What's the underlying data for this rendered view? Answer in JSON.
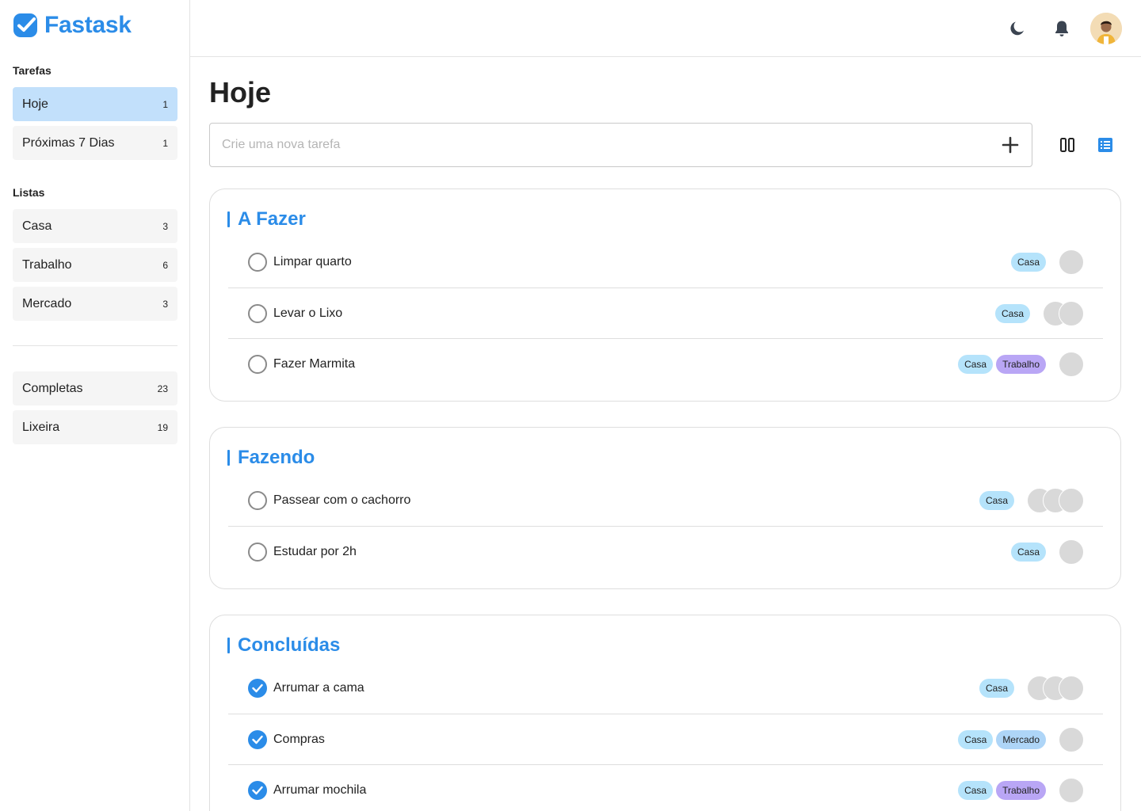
{
  "app": {
    "name": "Fastask",
    "accent": "#2b8ce8"
  },
  "sidebar": {
    "tasks_label": "Tarefas",
    "tasks": [
      {
        "label": "Hoje",
        "count": "1",
        "active": true
      },
      {
        "label": "Próximas 7 Dias",
        "count": "1",
        "active": false
      }
    ],
    "lists_label": "Listas",
    "lists": [
      {
        "label": "Casa",
        "count": "3"
      },
      {
        "label": "Trabalho",
        "count": "6"
      },
      {
        "label": "Mercado",
        "count": "3"
      }
    ],
    "other": [
      {
        "label": "Completas",
        "count": "23"
      },
      {
        "label": "Lixeira",
        "count": "19"
      }
    ]
  },
  "header": {
    "icons": [
      "moon-icon",
      "bell-icon"
    ],
    "avatar": "user-avatar"
  },
  "main": {
    "title": "Hoje",
    "new_task": {
      "placeholder": "Crie uma nova tarefa",
      "value": ""
    },
    "views": [
      "board-view-icon",
      "list-view-icon"
    ],
    "active_view": "list"
  },
  "sections": [
    {
      "title": "A Fazer",
      "tasks": [
        {
          "text": "Limpar quarto",
          "done": false,
          "tags": [
            "Casa"
          ],
          "assignees": 1
        },
        {
          "text": "Levar o Lixo",
          "done": false,
          "tags": [
            "Casa"
          ],
          "assignees": 2
        },
        {
          "text": "Fazer Marmita",
          "done": false,
          "tags": [
            "Casa",
            "Trabalho"
          ],
          "assignees": 1
        }
      ]
    },
    {
      "title": "Fazendo",
      "tasks": [
        {
          "text": "Passear com o cachorro",
          "done": false,
          "tags": [
            "Casa"
          ],
          "assignees": 3
        },
        {
          "text": "Estudar por 2h",
          "done": false,
          "tags": [
            "Casa"
          ],
          "assignees": 1
        }
      ]
    },
    {
      "title": "Concluídas",
      "tasks": [
        {
          "text": "Arrumar a cama",
          "done": true,
          "tags": [
            "Casa"
          ],
          "assignees": 3
        },
        {
          "text": "Compras",
          "done": true,
          "tags": [
            "Casa",
            "Mercado"
          ],
          "assignees": 1
        },
        {
          "text": "Arrumar mochila",
          "done": true,
          "tags": [
            "Casa",
            "Trabalho"
          ],
          "assignees": 1
        }
      ]
    }
  ]
}
